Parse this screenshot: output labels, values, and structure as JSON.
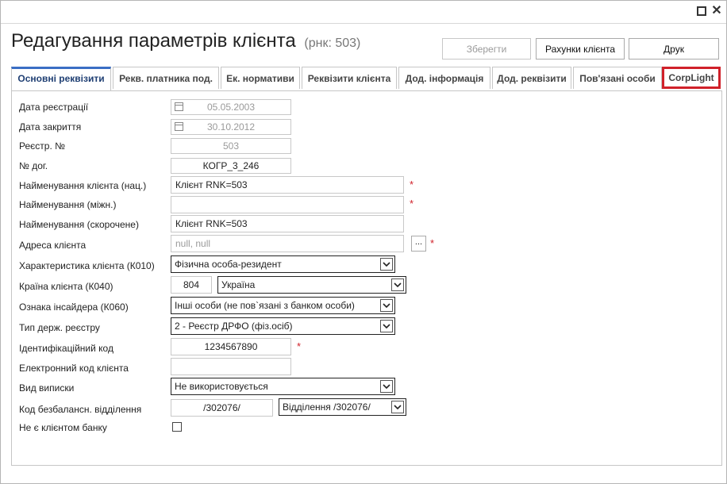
{
  "header": {
    "title": "Редагування параметрів клієнта",
    "subtitle": "(рнк: 503)",
    "buttons": {
      "save": "Зберегти",
      "accounts": "Рахунки клієнта",
      "print": "Друк"
    }
  },
  "tabs": [
    {
      "label": "Основні реквізити",
      "active": true
    },
    {
      "label": "Рекв. платника под."
    },
    {
      "label": "Ек. нормативи"
    },
    {
      "label": "Реквізити клієнта"
    },
    {
      "label": "Дод. інформація"
    },
    {
      "label": "Дод. реквізити"
    },
    {
      "label": "Пов'язані особи"
    },
    {
      "label": "CorpLight",
      "highlighted": true,
      "highlight_color": "#d0212a"
    }
  ],
  "form": {
    "reg_date": {
      "label": "Дата реєстрації",
      "value": "05.05.2003"
    },
    "close_date": {
      "label": "Дата закриття",
      "value": "30.10.2012"
    },
    "reg_number": {
      "label": "Реєстр. №",
      "value": "503"
    },
    "contract_no": {
      "label": "№ дог.",
      "value": "КОГР_3_246"
    },
    "name_nat": {
      "label": "Найменування клієнта (нац.)",
      "value": "Клієнт RNK=503",
      "required": "*"
    },
    "name_int": {
      "label": "Найменування (міжн.)",
      "value": "",
      "required": "*"
    },
    "name_short": {
      "label": "Найменування (скорочене)",
      "value": "Клієнт RNK=503"
    },
    "address": {
      "label": "Адреса клієнта",
      "placeholder": "null, null",
      "button": "...",
      "required": "*"
    },
    "k010": {
      "label": "Характеристика клієнта (К010)",
      "value": "Фізична особа-резидент"
    },
    "k040": {
      "label": "Країна клієнта (К040)",
      "code": "804",
      "value": "Україна"
    },
    "k060": {
      "label": "Ознака інсайдера (К060)",
      "value": "Інші особи (не пов`язані з банком особи)"
    },
    "registry": {
      "label": "Тип держ. реєстру",
      "value": "2 - Реєстр ДРФО (фіз.осіб)"
    },
    "id_code": {
      "label": "Ідентифікаційний код",
      "value": "1234567890",
      "required": "*"
    },
    "e_code": {
      "label": "Електронний код клієнта",
      "value": ""
    },
    "statement": {
      "label": "Вид виписки",
      "value": "Не використовується"
    },
    "branch": {
      "label": "Код безбалансн. відділення",
      "code": "/302076/",
      "value": "Відділення /302076/"
    },
    "not_client": {
      "label": "Не є клієнтом банку",
      "checked": false
    }
  },
  "colors": {
    "accent": "#3a6ec4",
    "required": "#d0212a",
    "highlight": "#d0212a"
  }
}
